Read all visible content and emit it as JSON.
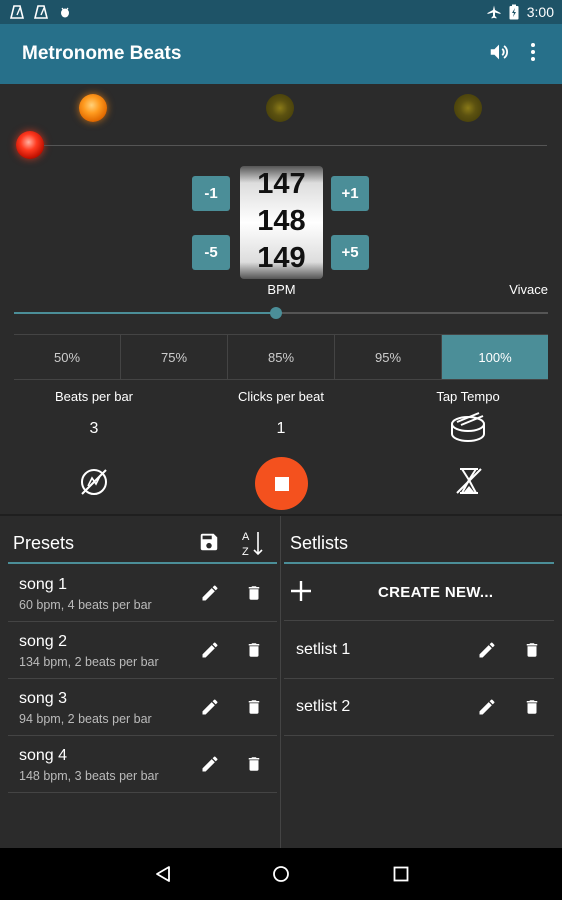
{
  "status_bar": {
    "time": "3:00"
  },
  "app_bar": {
    "title": "Metronome Beats",
    "volume_icon": "volume-icon",
    "menu_icon": "overflow-menu-icon"
  },
  "metronome": {
    "bpm_prev": "147",
    "bpm_current": "148",
    "bpm_next": "149",
    "bpm_label": "BPM",
    "tempo_name": "Vivace",
    "btn_minus1": "-1",
    "btn_plus1": "+1",
    "btn_minus5": "-5",
    "btn_plus5": "+5",
    "slider_fraction": 0.49,
    "percentages": [
      "50%",
      "75%",
      "85%",
      "95%",
      "100%"
    ],
    "active_percentage": "100%",
    "beats_per_bar_label": "Beats per bar",
    "beats_per_bar_value": "3",
    "clicks_per_beat_label": "Clicks per beat",
    "clicks_per_beat_value": "1",
    "tap_tempo_label": "Tap Tempo",
    "accent_color": "#4b8e98",
    "stop_color": "#f4511e"
  },
  "presets": {
    "title": "Presets",
    "items": [
      {
        "name": "song 1",
        "detail": "60 bpm, 4 beats per bar"
      },
      {
        "name": "song 2",
        "detail": "134 bpm, 2 beats per bar"
      },
      {
        "name": "song 3",
        "detail": "94 bpm, 2 beats per bar"
      },
      {
        "name": "song 4",
        "detail": "148 bpm, 3 beats per bar"
      }
    ]
  },
  "setlists": {
    "title": "Setlists",
    "create_label": "CREATE NEW...",
    "items": [
      {
        "name": "setlist 1"
      },
      {
        "name": "setlist 2"
      }
    ]
  }
}
